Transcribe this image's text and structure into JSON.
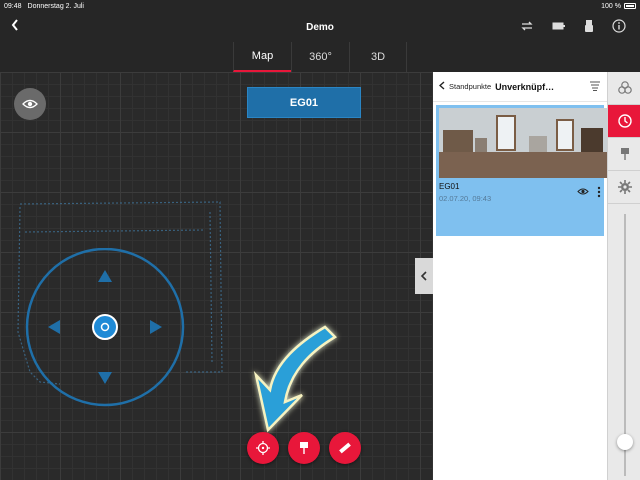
{
  "status": {
    "time": "09:48",
    "date": "Donnerstag 2. Juli",
    "battery": "100 %"
  },
  "nav": {
    "title": "Demo",
    "icons": [
      "back-icon",
      "swap-icon",
      "battery-icon",
      "scanner-icon",
      "info-icon"
    ]
  },
  "tabs": [
    {
      "label": "Map",
      "active": true
    },
    {
      "label": "360°",
      "active": false
    },
    {
      "label": "3D",
      "active": false
    }
  ],
  "map": {
    "floor_label": "EG01",
    "fab_icons": [
      "target-icon",
      "pin-icon",
      "measure-icon"
    ]
  },
  "panel": {
    "breadcrumb": "Standpunkte",
    "heading": "Unverknüpf…",
    "items": [
      {
        "name": "EG01",
        "date": "02.07.20, 09:43",
        "selected": true
      }
    ]
  },
  "rail": {
    "icons": [
      "layers-icon",
      "stations-icon",
      "pin-icon",
      "settings-icon"
    ],
    "active_index": 1,
    "slider_level": 0.13
  },
  "colors": {
    "accent": "#e8173a",
    "selection": "#7fc0ef",
    "map_blue": "#1f6fa8"
  }
}
